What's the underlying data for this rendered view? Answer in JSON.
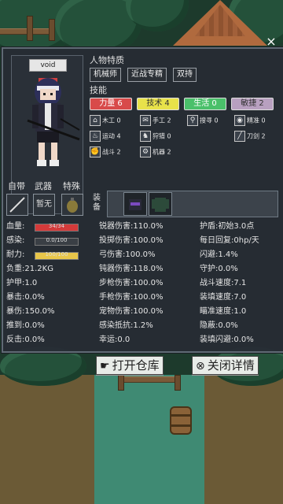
{
  "header": {
    "close_label": "×"
  },
  "character": {
    "name": "void"
  },
  "traits": {
    "title": "人物特质",
    "items": [
      "机械师",
      "近战专精",
      "双持"
    ]
  },
  "skills": {
    "title": "技能",
    "main": [
      {
        "label": "力量 6",
        "color": "#d84a4a"
      },
      {
        "label": "技术 4",
        "color": "#e8e24a"
      },
      {
        "label": "生活 0",
        "color": "#4ac06a"
      },
      {
        "label": "敏捷 2",
        "color": "#b8a0c0"
      }
    ],
    "sub": [
      {
        "icon": "⌂",
        "label": "木工 0"
      },
      {
        "icon": "✉",
        "label": "手工 2"
      },
      {
        "icon": "⚲",
        "label": "搜寻 0"
      },
      {
        "icon": "◉",
        "label": "精准 0"
      },
      {
        "icon": "♨",
        "label": "运动 4"
      },
      {
        "icon": "♞",
        "label": "狩猎 0"
      },
      {
        "icon": "",
        "label": ""
      },
      {
        "icon": "╱",
        "label": "刀剑 2"
      },
      {
        "icon": "✊",
        "label": "战斗 2"
      },
      {
        "icon": "⚙",
        "label": "机器 2"
      }
    ]
  },
  "slots": {
    "labels": [
      "自带",
      "武器",
      "特殊"
    ],
    "weapon_text": "暂无",
    "equip_label": "装备"
  },
  "stats_left": [
    {
      "label": "血量:",
      "bar": "34/34",
      "bar_fill": 1.0,
      "color": "#d43a3a"
    },
    {
      "label": "感染:",
      "bar": "0.0/100",
      "bar_fill": 0.0,
      "color": "#6a8ad0"
    },
    {
      "label": "耐力:",
      "bar": "100/100",
      "bar_fill": 1.0,
      "color": "#e8c64a"
    },
    {
      "label": "负重:",
      "value": "21.2KG"
    },
    {
      "label": "护甲:",
      "value": "1.0"
    },
    {
      "label": "暴击:",
      "value": "0.0%"
    },
    {
      "label": "暴伤:",
      "value": "150.0%"
    },
    {
      "label": "推到:",
      "value": "0.0%"
    },
    {
      "label": "反击:",
      "value": "0.0%"
    }
  ],
  "stats_mid": [
    {
      "label": "锐器伤害:",
      "value": "110.0%"
    },
    {
      "label": "投掷伤害:",
      "value": "100.0%"
    },
    {
      "label": "弓伤害:",
      "value": "100.0%"
    },
    {
      "label": "钝器伤害:",
      "value": "118.0%"
    },
    {
      "label": "步枪伤害:",
      "value": "100.0%"
    },
    {
      "label": "手枪伤害:",
      "value": "100.0%"
    },
    {
      "label": "宠物伤害:",
      "value": "100.0%"
    },
    {
      "label": "感染抵抗:",
      "value": "1.2%"
    },
    {
      "label": "幸运:",
      "value": "0.0"
    }
  ],
  "stats_right": [
    {
      "label": "护盾:",
      "value": "初始3.0点"
    },
    {
      "label": "每日回复:",
      "value": "0hp/天"
    },
    {
      "label": "闪避:",
      "value": "1.4%"
    },
    {
      "label": "守护:",
      "value": "0.0%"
    },
    {
      "label": "战斗速度:",
      "value": "7.1"
    },
    {
      "label": "装填速度:",
      "value": "7.0"
    },
    {
      "label": "瞄准速度:",
      "value": "1.0"
    },
    {
      "label": "隐蔽:",
      "value": "0.0%"
    },
    {
      "label": "装填闪避:",
      "value": "0.0%"
    }
  ],
  "buttons": {
    "open_warehouse": "打开仓库",
    "close_detail": "关闭详情"
  }
}
